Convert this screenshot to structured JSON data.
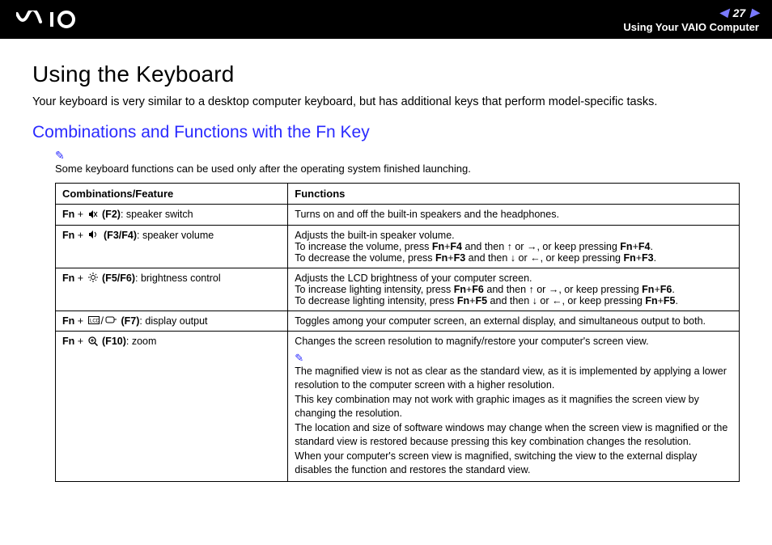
{
  "header": {
    "page_number": "27",
    "section": "Using Your VAIO Computer"
  },
  "title": "Using the Keyboard",
  "intro": "Your keyboard is very similar to a desktop computer keyboard, but has additional keys that perform model-specific tasks.",
  "subtitle": "Combinations and Functions with the Fn Key",
  "note": "Some keyboard functions can be used only after the operating system finished launching.",
  "table": {
    "head": {
      "col1": "Combinations/Feature",
      "col2": "Functions"
    },
    "rows": {
      "r1": {
        "combo_prefix": "Fn",
        "combo_key": "(F2)",
        "combo_label": ": speaker switch",
        "func": "Turns on and off the built-in speakers and the headphones."
      },
      "r2": {
        "combo_prefix": "Fn",
        "combo_key": "(F3/F4)",
        "combo_label": ": speaker volume",
        "func_l1": "Adjusts the built-in speaker volume.",
        "func_l2a": "To increase the volume, press ",
        "func_l2b": "Fn",
        "func_l2c": "F4",
        "func_l2d": " and then ",
        "func_l2e": ", or keep pressing ",
        "func_l2f": "Fn",
        "func_l2g": "F4",
        "func_l3a": "To decrease the volume, press ",
        "func_l3b": "Fn",
        "func_l3c": "F3",
        "func_l3d": " and then ",
        "func_l3e": ", or keep pressing ",
        "func_l3f": "Fn",
        "func_l3g": "F3"
      },
      "r3": {
        "combo_prefix": "Fn",
        "combo_key": "(F5/F6)",
        "combo_label": ": brightness control",
        "func_l1": "Adjusts the LCD brightness of your computer screen.",
        "func_l2a": "To increase lighting intensity, press ",
        "func_l2b": "Fn",
        "func_l2c": "F6",
        "func_l2d": " and then ",
        "func_l2e": ", or keep pressing ",
        "func_l2f": "Fn",
        "func_l2g": "F6",
        "func_l3a": "To decrease lighting intensity, press ",
        "func_l3b": "Fn",
        "func_l3c": "F5",
        "func_l3d": " and then ",
        "func_l3e": ", or keep pressing ",
        "func_l3f": "Fn",
        "func_l3g": "F5"
      },
      "r4": {
        "combo_prefix": "Fn",
        "combo_key": "(F7)",
        "combo_label": ": display output",
        "func": "Toggles among your computer screen, an external display, and simultaneous output to both."
      },
      "r5": {
        "combo_prefix": "Fn",
        "combo_key": "(F10)",
        "combo_label": ": zoom",
        "func_l1": "Changes the screen resolution to magnify/restore your computer's screen view.",
        "note1": "The magnified view is not as clear as the standard view, as it is implemented by applying a lower resolution to the computer screen with a higher resolution.",
        "note2": "This key combination may not work with graphic images as it magnifies the screen view by changing the resolution.",
        "note3": "The location and size of software windows may change when the screen view is magnified or the standard view is restored because pressing this key combination changes the resolution.",
        "note4": "When your computer's screen view is magnified, switching the view to the external display disables the function and restores the standard view."
      }
    }
  },
  "or_text": " or "
}
